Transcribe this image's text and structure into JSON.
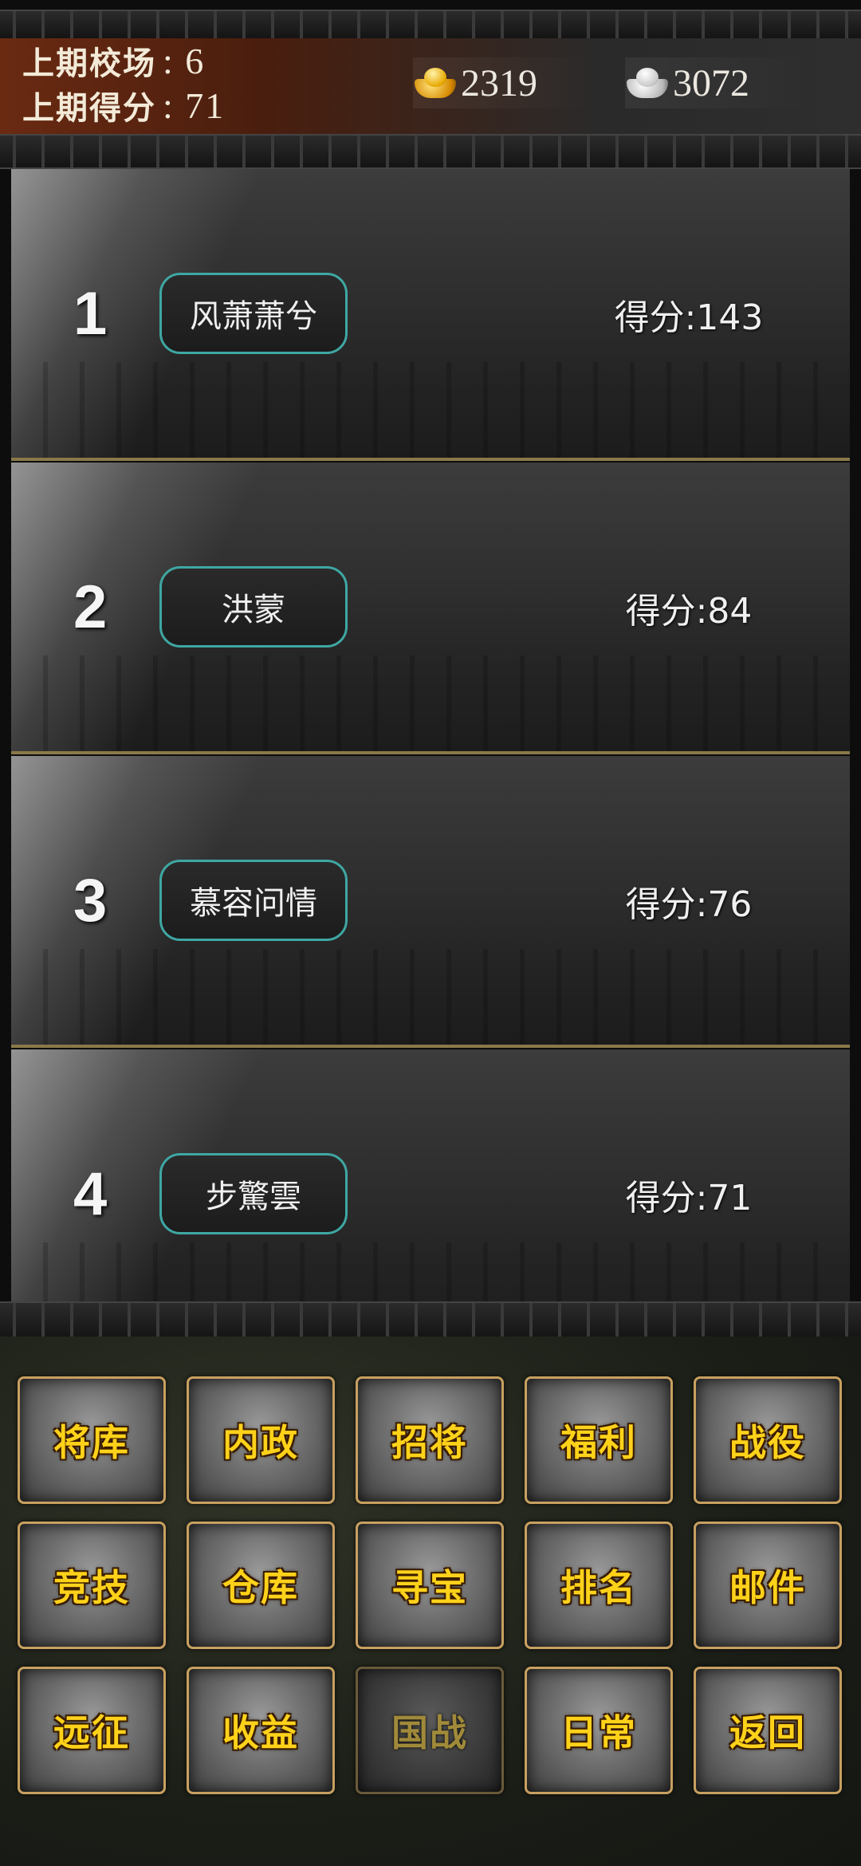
{
  "header": {
    "last_field_label": "上期校场",
    "last_field_value": ": 6",
    "last_score_label": "上期得分",
    "last_score_value": ": 71",
    "gold_icon": "gold-ingot-icon",
    "gold_amount": "2319",
    "silver_icon": "silver-ingot-icon",
    "silver_amount": "3072"
  },
  "rankings": [
    {
      "rank": "1",
      "name": "风萧萧兮",
      "score": "得分:143"
    },
    {
      "rank": "2",
      "name": "洪蒙",
      "score": "得分:84"
    },
    {
      "rank": "3",
      "name": "慕容问情",
      "score": "得分:76"
    },
    {
      "rank": "4",
      "name": "步驚雲",
      "score": "得分:71"
    }
  ],
  "menu": {
    "items": [
      {
        "label": "将库"
      },
      {
        "label": "内政"
      },
      {
        "label": "招将"
      },
      {
        "label": "福利"
      },
      {
        "label": "战役"
      },
      {
        "label": "竞技"
      },
      {
        "label": "仓库"
      },
      {
        "label": "寻宝"
      },
      {
        "label": "排名"
      },
      {
        "label": "邮件"
      },
      {
        "label": "远征"
      },
      {
        "label": "收益"
      },
      {
        "label": "国战",
        "disabled": true
      },
      {
        "label": "日常"
      },
      {
        "label": "返回"
      }
    ]
  },
  "colors": {
    "accent_gold": "#ffd21a",
    "pill_border": "#3fa7a3",
    "header_brown": "#6a2a12"
  }
}
